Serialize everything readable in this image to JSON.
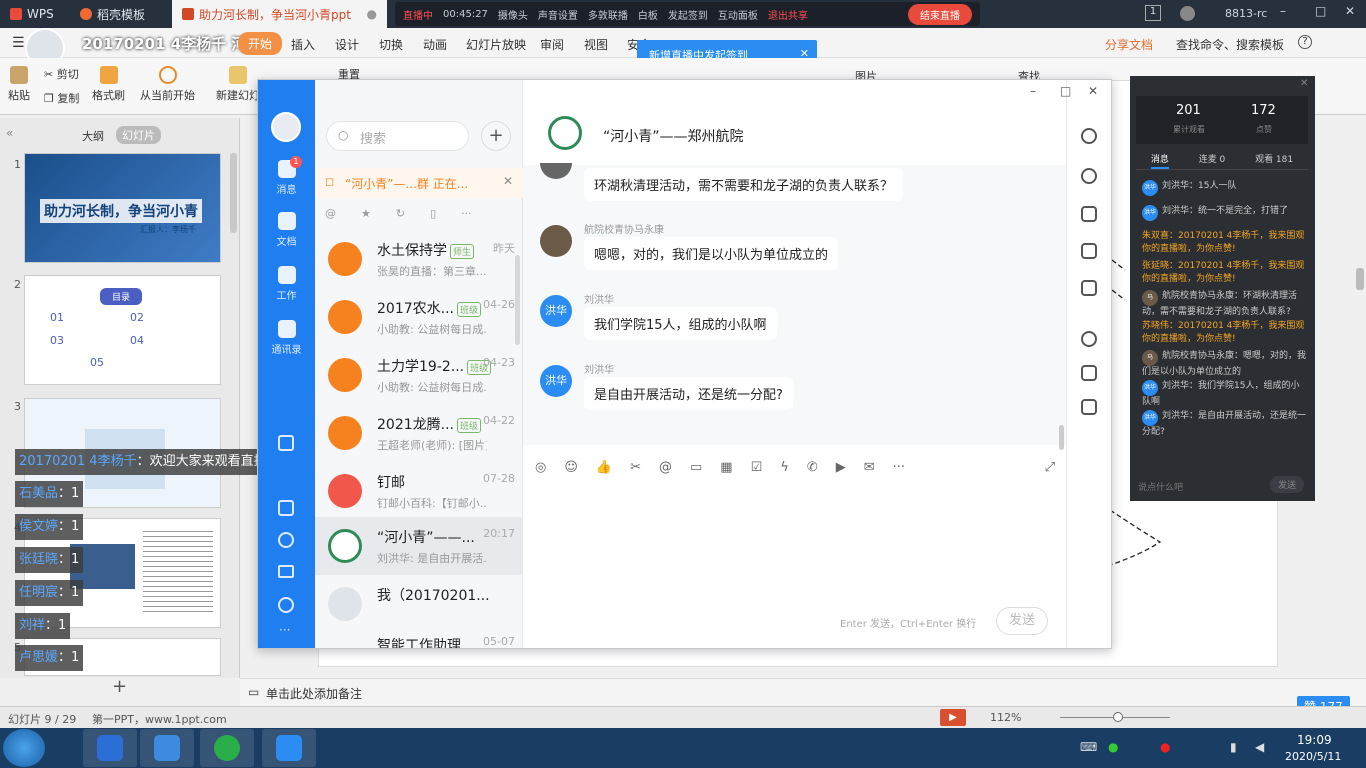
{
  "titlebar": {
    "wps": "WPS",
    "tab1": "稻壳模板",
    "tab2": "助力河长制，争当河小青ppt",
    "live_status": "直播中",
    "live_time": "00:45:27",
    "live_items": [
      "摄像头",
      "声音设置",
      "多敦联播",
      "白板",
      "发起签到",
      "互动面板",
      "退出共享"
    ],
    "end_button": "结束直播",
    "user": "8813-rc"
  },
  "menubar": {
    "doc_title": "20170201 4李杨千 河小青",
    "start": "开始",
    "items": [
      "插入",
      "设计",
      "切换",
      "动画",
      "幻灯片放映",
      "审阅",
      "视图",
      "安全"
    ],
    "share": "分享文档",
    "search": "查找命令、搜索模板",
    "tooltip": "新增直播中发起签到"
  },
  "ribbon": {
    "paste": "粘贴",
    "cut": "剪切",
    "copy": "复制",
    "format_painter": "格式刷",
    "play_from_current": "从当前开始",
    "new_slide": "新建幻灯",
    "reset": "重置",
    "picture": "图片",
    "find": "查找"
  },
  "leftpane": {
    "tab_outline": "大纲",
    "tab_slides": "幻灯片",
    "slide1_title": "助力河长制，争当河小青",
    "slide1_presenter": "汇报人：李杨千",
    "slide2_title": "目录",
    "slide2_items": [
      "01",
      "02",
      "03",
      "04",
      "05"
    ],
    "numbers": [
      "1",
      "2",
      "3",
      "4",
      "5"
    ],
    "add": "+"
  },
  "danmaku": [
    {
      "name": "20170201 4李杨千",
      "text": "：欢迎大家来观看直播 “河小青”。"
    },
    {
      "name": "石美品",
      "text": "：1"
    },
    {
      "name": "侯文婷",
      "text": "：1"
    },
    {
      "name": "张廷晓",
      "text": "：1"
    },
    {
      "name": "任明宸",
      "text": "：1"
    },
    {
      "name": "刘祥",
      "text": "：1"
    },
    {
      "name": "卢思媛",
      "text": "：1"
    }
  ],
  "ding": {
    "nav": [
      "消息",
      "文档",
      "工作",
      "通讯录"
    ],
    "nav_badge": "1",
    "search_placeholder": "搜索",
    "pinned": "“河小青”—...群 正在...",
    "conversations": [
      {
        "title": "水土保持学",
        "badge": "师生",
        "sub": "张昊的直播：第三章...",
        "time": "昨天"
      },
      {
        "title": "2017农水...",
        "badge": "班级",
        "sub": "小助教: 公益树每日成...",
        "time": "04-26"
      },
      {
        "title": "土力学19-2...",
        "badge": "班级",
        "sub": "小助教: 公益树每日成...",
        "time": "04-23"
      },
      {
        "title": "2021龙腾...",
        "badge": "班级",
        "sub": "王超老师(老师): [图片]",
        "time": "04-22"
      },
      {
        "title": "钉邮",
        "badge": "",
        "sub": "钉邮小百科:【钉邮小...",
        "time": "07-28"
      },
      {
        "title": "“河小青”——...",
        "badge": "",
        "sub": "刘洪华: 是自由开展活...",
        "time": "20:17"
      },
      {
        "title": "我（20170201...",
        "badge": "",
        "sub": "",
        "time": ""
      },
      {
        "title": "智能工作助理",
        "badge": "",
        "sub": "",
        "time": "05-07"
      }
    ],
    "chat_title": "“河小青”——郑州航院",
    "messages": [
      {
        "sender": "",
        "avatar": "",
        "text": "环湖秋清理活动，需不需要和龙子湖的负责人联系？"
      },
      {
        "sender": "航院校青协马永康",
        "avatar": "",
        "text": "嗯嗯，对的，我们是以小队为单位成立的"
      },
      {
        "sender": "刘洪华",
        "avatar": "洪华",
        "text": "我们学院15人，组成的小队啊"
      },
      {
        "sender": "刘洪华",
        "avatar": "洪华",
        "text": "是自由开展活动，还是统一分配?"
      }
    ],
    "input_hint": "Enter 发送，Ctrl+Enter 换行",
    "send": "发送"
  },
  "livepanel": {
    "viewers": "201",
    "viewers_label": "累计观看",
    "likes": "172",
    "likes_label": "点赞",
    "tabs": [
      "消息",
      "连麦 0",
      "观看 181"
    ],
    "comments": [
      {
        "who": "洪华",
        "text": "刘洪华：15人一队",
        "hl": false
      },
      {
        "who": "洪华",
        "text": "刘洪华：统一不是完全，打错了",
        "hl": false
      },
      {
        "who": "",
        "text": "朱双喜：20170201 4李杨千，我来围观你的直播啦，为你点赞!",
        "hl": true
      },
      {
        "who": "",
        "text": "张延晓：20170201 4李杨千，我来围观你的直播啦，为你点赞!",
        "hl": true
      },
      {
        "who": "马",
        "text": "航院校青协马永康：环湖秋清理活动，需不需要和龙子湖的负责人联系?",
        "hl": false
      },
      {
        "who": "",
        "text": "苏晓伟：20170201 4李杨千，我来围观你的直播啦，为你点赞!",
        "hl": true
      },
      {
        "who": "马",
        "text": "航院校青协马永康：嗯嗯，对的，我们是以小队为单位成立的",
        "hl": false
      },
      {
        "who": "洪华",
        "text": "刘洪华：我们学院15人，组成的小队啊",
        "hl": false
      },
      {
        "who": "洪华",
        "text": "刘洪华：是自由开展活动，还是统一分配?",
        "hl": false
      }
    ],
    "input": "说点什么吧",
    "send": "发送"
  },
  "statusbar": {
    "slide": "幻灯片 9 / 29",
    "theme": "第一PPT，www.1ppt.com",
    "note": "单击此处添加备注",
    "zoom": "112%",
    "likes": "赞 177"
  },
  "taskbar": {
    "time": "19:09",
    "date": "2020/5/11"
  }
}
